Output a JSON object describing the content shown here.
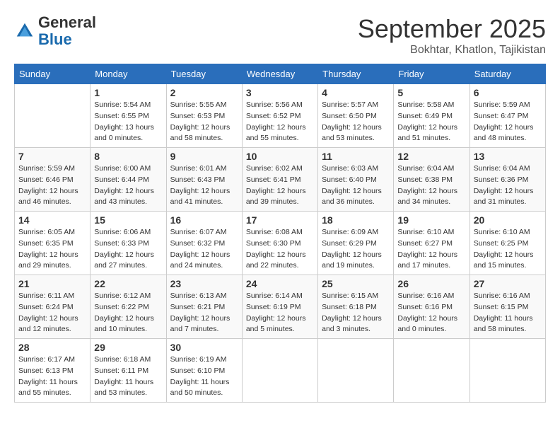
{
  "header": {
    "logo_general": "General",
    "logo_blue": "Blue",
    "month": "September 2025",
    "location": "Bokhtar, Khatlon, Tajikistan"
  },
  "days_of_week": [
    "Sunday",
    "Monday",
    "Tuesday",
    "Wednesday",
    "Thursday",
    "Friday",
    "Saturday"
  ],
  "weeks": [
    [
      null,
      {
        "day": 1,
        "sunrise": "5:54 AM",
        "sunset": "6:55 PM",
        "daylight": "13 hours and 0 minutes."
      },
      {
        "day": 2,
        "sunrise": "5:55 AM",
        "sunset": "6:53 PM",
        "daylight": "12 hours and 58 minutes."
      },
      {
        "day": 3,
        "sunrise": "5:56 AM",
        "sunset": "6:52 PM",
        "daylight": "12 hours and 55 minutes."
      },
      {
        "day": 4,
        "sunrise": "5:57 AM",
        "sunset": "6:50 PM",
        "daylight": "12 hours and 53 minutes."
      },
      {
        "day": 5,
        "sunrise": "5:58 AM",
        "sunset": "6:49 PM",
        "daylight": "12 hours and 51 minutes."
      },
      {
        "day": 6,
        "sunrise": "5:59 AM",
        "sunset": "6:47 PM",
        "daylight": "12 hours and 48 minutes."
      }
    ],
    [
      {
        "day": 7,
        "sunrise": "5:59 AM",
        "sunset": "6:46 PM",
        "daylight": "12 hours and 46 minutes."
      },
      {
        "day": 8,
        "sunrise": "6:00 AM",
        "sunset": "6:44 PM",
        "daylight": "12 hours and 43 minutes."
      },
      {
        "day": 9,
        "sunrise": "6:01 AM",
        "sunset": "6:43 PM",
        "daylight": "12 hours and 41 minutes."
      },
      {
        "day": 10,
        "sunrise": "6:02 AM",
        "sunset": "6:41 PM",
        "daylight": "12 hours and 39 minutes."
      },
      {
        "day": 11,
        "sunrise": "6:03 AM",
        "sunset": "6:40 PM",
        "daylight": "12 hours and 36 minutes."
      },
      {
        "day": 12,
        "sunrise": "6:04 AM",
        "sunset": "6:38 PM",
        "daylight": "12 hours and 34 minutes."
      },
      {
        "day": 13,
        "sunrise": "6:04 AM",
        "sunset": "6:36 PM",
        "daylight": "12 hours and 31 minutes."
      }
    ],
    [
      {
        "day": 14,
        "sunrise": "6:05 AM",
        "sunset": "6:35 PM",
        "daylight": "12 hours and 29 minutes."
      },
      {
        "day": 15,
        "sunrise": "6:06 AM",
        "sunset": "6:33 PM",
        "daylight": "12 hours and 27 minutes."
      },
      {
        "day": 16,
        "sunrise": "6:07 AM",
        "sunset": "6:32 PM",
        "daylight": "12 hours and 24 minutes."
      },
      {
        "day": 17,
        "sunrise": "6:08 AM",
        "sunset": "6:30 PM",
        "daylight": "12 hours and 22 minutes."
      },
      {
        "day": 18,
        "sunrise": "6:09 AM",
        "sunset": "6:29 PM",
        "daylight": "12 hours and 19 minutes."
      },
      {
        "day": 19,
        "sunrise": "6:10 AM",
        "sunset": "6:27 PM",
        "daylight": "12 hours and 17 minutes."
      },
      {
        "day": 20,
        "sunrise": "6:10 AM",
        "sunset": "6:25 PM",
        "daylight": "12 hours and 15 minutes."
      }
    ],
    [
      {
        "day": 21,
        "sunrise": "6:11 AM",
        "sunset": "6:24 PM",
        "daylight": "12 hours and 12 minutes."
      },
      {
        "day": 22,
        "sunrise": "6:12 AM",
        "sunset": "6:22 PM",
        "daylight": "12 hours and 10 minutes."
      },
      {
        "day": 23,
        "sunrise": "6:13 AM",
        "sunset": "6:21 PM",
        "daylight": "12 hours and 7 minutes."
      },
      {
        "day": 24,
        "sunrise": "6:14 AM",
        "sunset": "6:19 PM",
        "daylight": "12 hours and 5 minutes."
      },
      {
        "day": 25,
        "sunrise": "6:15 AM",
        "sunset": "6:18 PM",
        "daylight": "12 hours and 3 minutes."
      },
      {
        "day": 26,
        "sunrise": "6:16 AM",
        "sunset": "6:16 PM",
        "daylight": "12 hours and 0 minutes."
      },
      {
        "day": 27,
        "sunrise": "6:16 AM",
        "sunset": "6:15 PM",
        "daylight": "11 hours and 58 minutes."
      }
    ],
    [
      {
        "day": 28,
        "sunrise": "6:17 AM",
        "sunset": "6:13 PM",
        "daylight": "11 hours and 55 minutes."
      },
      {
        "day": 29,
        "sunrise": "6:18 AM",
        "sunset": "6:11 PM",
        "daylight": "11 hours and 53 minutes."
      },
      {
        "day": 30,
        "sunrise": "6:19 AM",
        "sunset": "6:10 PM",
        "daylight": "11 hours and 50 minutes."
      },
      null,
      null,
      null,
      null
    ]
  ]
}
